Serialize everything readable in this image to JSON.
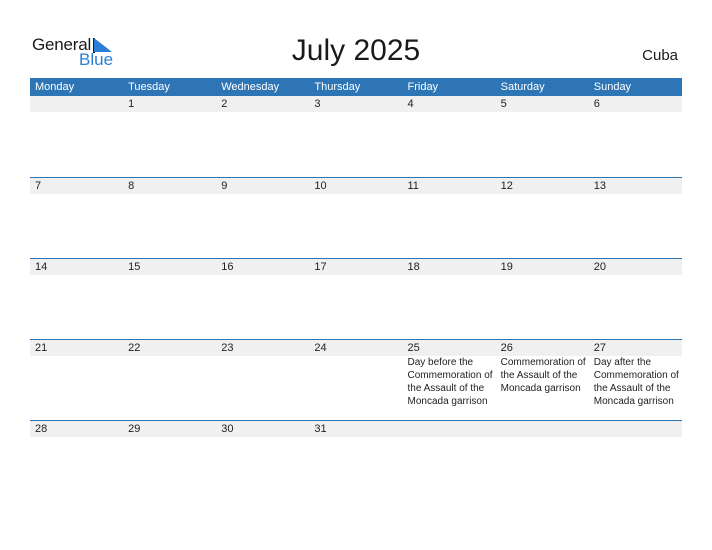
{
  "logo": {
    "general": "General",
    "blue": "Blue"
  },
  "title": "July 2025",
  "country": "Cuba",
  "days": [
    "Monday",
    "Tuesday",
    "Wednesday",
    "Thursday",
    "Friday",
    "Saturday",
    "Sunday"
  ],
  "weeks": [
    {
      "dates": [
        "",
        "1",
        "2",
        "3",
        "4",
        "5",
        "6"
      ],
      "events": [
        "",
        "",
        "",
        "",
        "",
        "",
        ""
      ]
    },
    {
      "dates": [
        "7",
        "8",
        "9",
        "10",
        "11",
        "12",
        "13"
      ],
      "events": [
        "",
        "",
        "",
        "",
        "",
        "",
        ""
      ]
    },
    {
      "dates": [
        "14",
        "15",
        "16",
        "17",
        "18",
        "19",
        "20"
      ],
      "events": [
        "",
        "",
        "",
        "",
        "",
        "",
        ""
      ]
    },
    {
      "dates": [
        "21",
        "22",
        "23",
        "24",
        "25",
        "26",
        "27"
      ],
      "events": [
        "",
        "",
        "",
        "",
        "Day before the Commemoration of the Assault of the Moncada garrison",
        "Commemoration of the Assault of the Moncada garrison",
        "Day after the Commemoration of the Assault of the Moncada garrison"
      ]
    },
    {
      "dates": [
        "28",
        "29",
        "30",
        "31",
        "",
        "",
        ""
      ],
      "events": [
        "",
        "",
        "",
        "",
        "",
        "",
        ""
      ]
    }
  ]
}
